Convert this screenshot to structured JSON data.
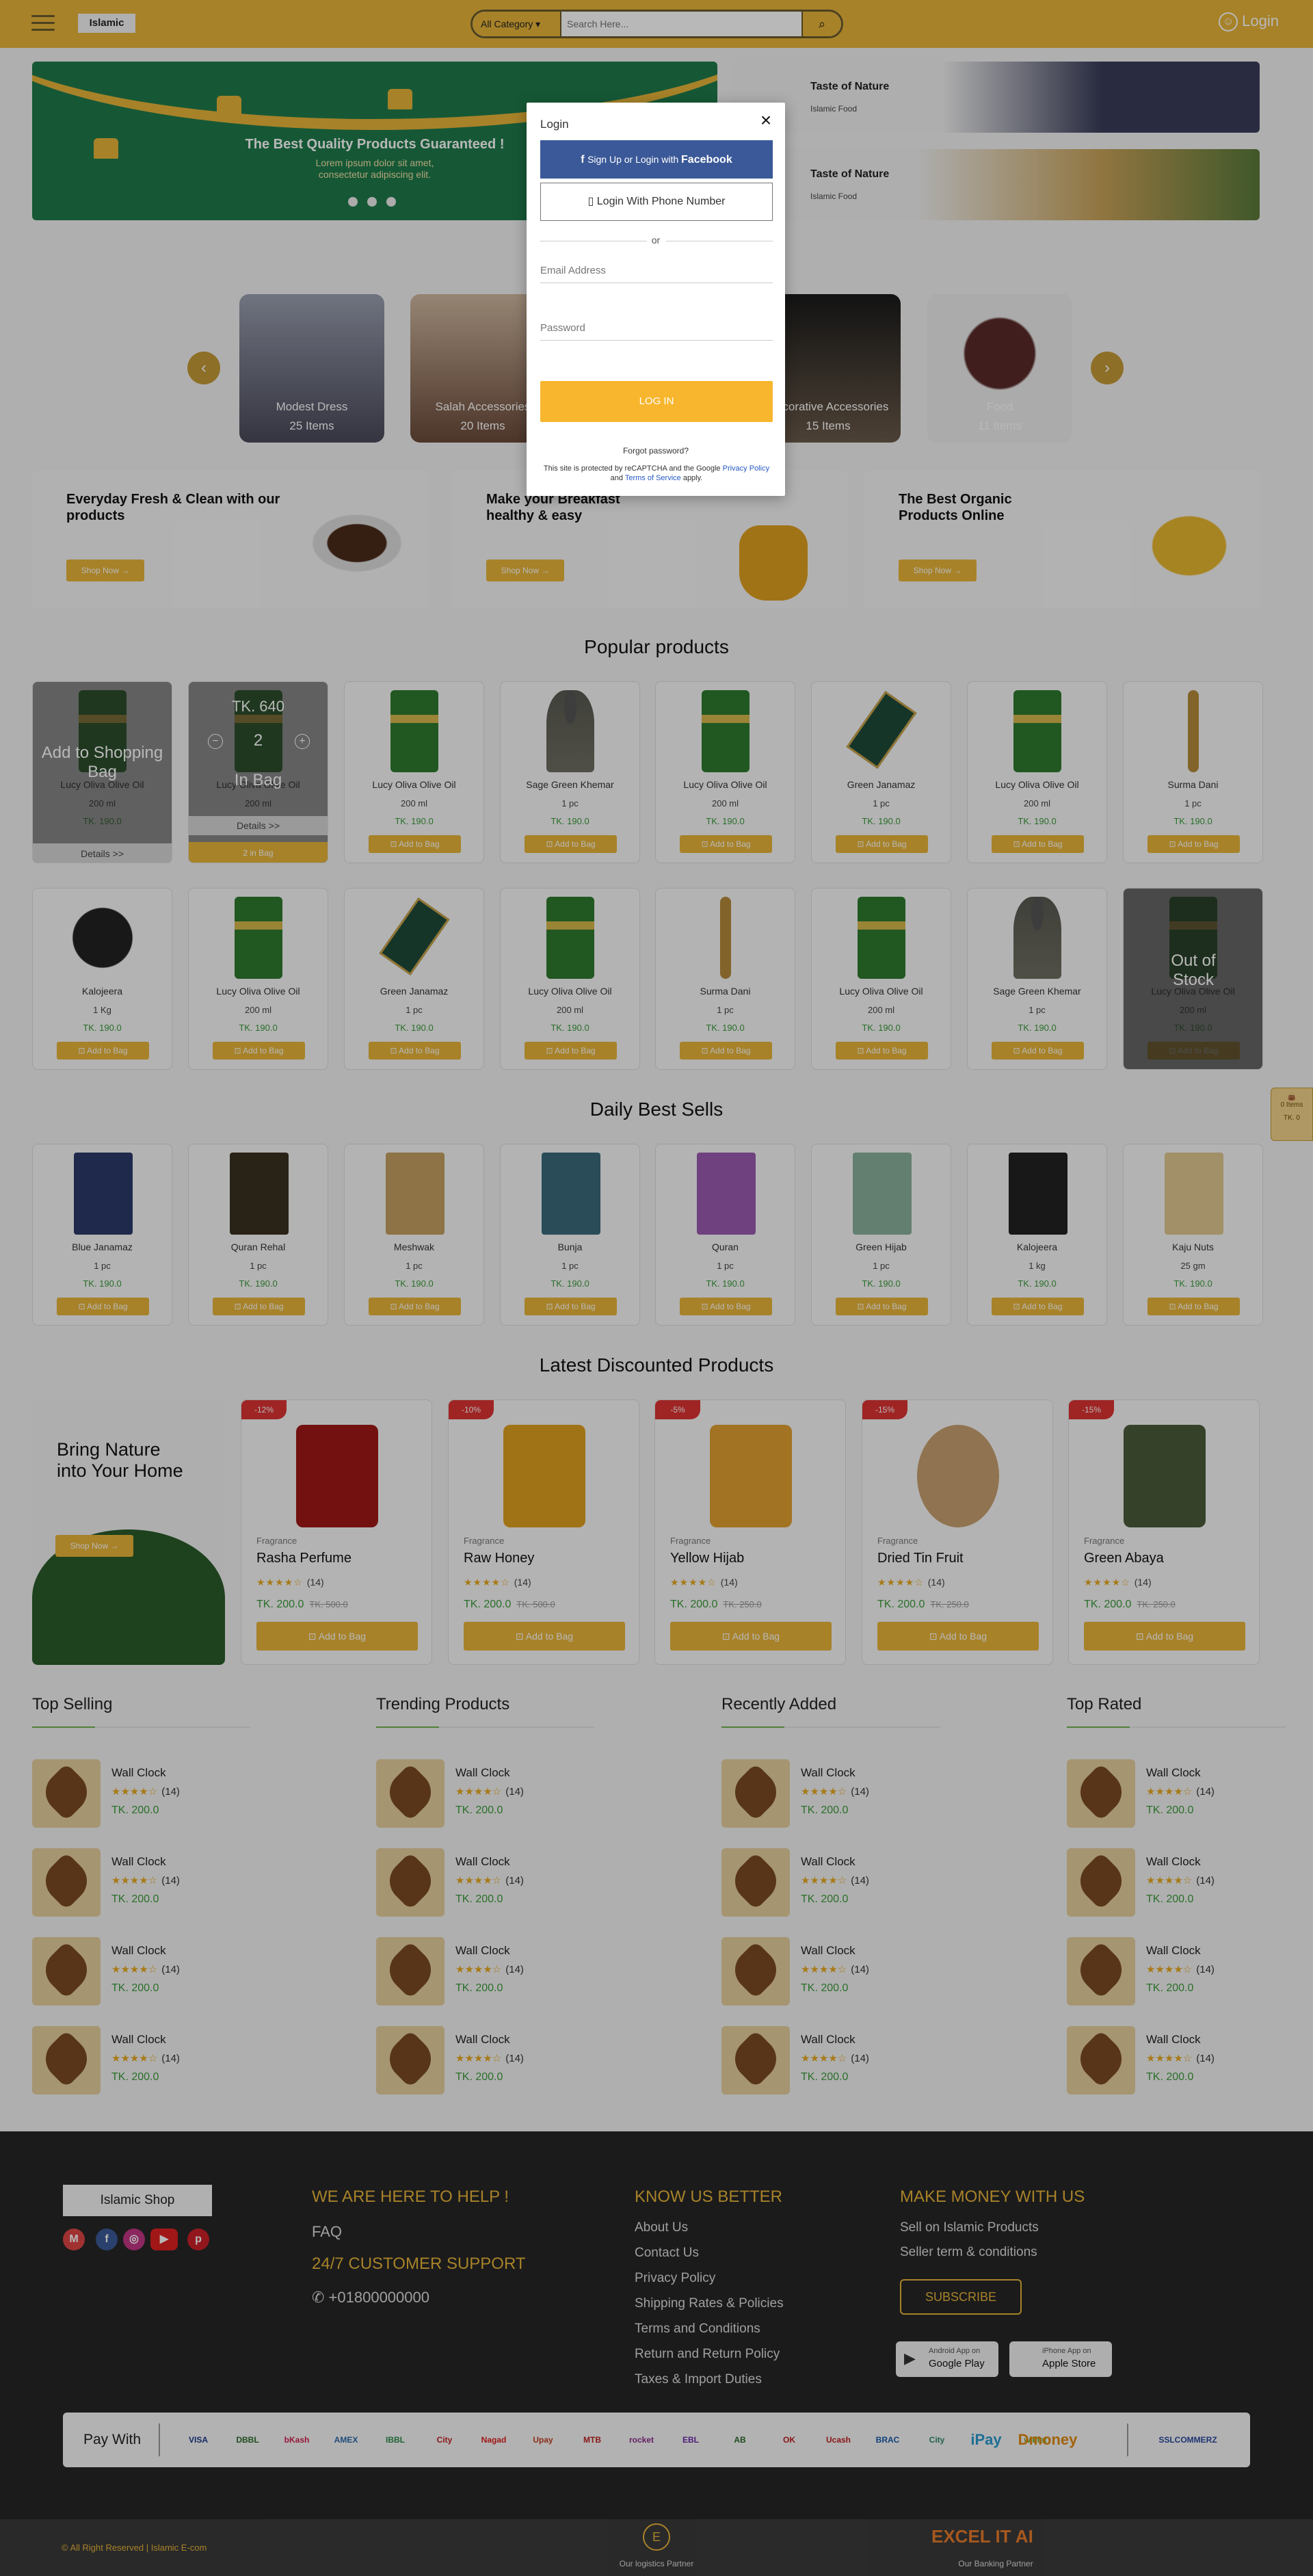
{
  "header": {
    "logo": "Islamic",
    "category_select": "All Category",
    "search_placeholder": "Search Here...",
    "login": "Login"
  },
  "hero": {
    "title": "The Best Quality Products Guaranteed !",
    "subtitle": "Lorem ipsum dolor sit amet,",
    "subtitle2": "consectetur adipiscing elit."
  },
  "side_banners": [
    {
      "title": "Taste of Nature",
      "sub": "Islamic Food"
    },
    {
      "title": "Taste of Nature",
      "sub": "Islamic Food"
    }
  ],
  "categories": [
    {
      "name": "Modest Dress",
      "count": "25 Items",
      "color": "#6b6a7a"
    },
    {
      "name": "Salah Accessories",
      "count": "20 Items",
      "color": "#8a6b52"
    },
    {
      "name": "Decorative Accessories",
      "count": "15 Items",
      "color": "#5a4a3a"
    },
    {
      "name": "Food",
      "count": "11 Items",
      "color": "#8a7a7a"
    }
  ],
  "promos": [
    {
      "title": "Everyday Fresh & Clean with our products",
      "btn": "Shop Now"
    },
    {
      "title": "Make your Breakfast healthy & easy",
      "btn": "Shop Now"
    },
    {
      "title": "The Best Organic Products Online",
      "btn": "Shop Now"
    }
  ],
  "popular_title": "Popular products",
  "popular_row1": [
    {
      "name": "Lucy Oliva Olive Oil",
      "qty": "200 ml",
      "price": "TK. 190.0",
      "img": "oil"
    },
    {
      "name": "Lucy Oliva Olive Oil",
      "qty": "200 ml",
      "price": "TK. 190.0",
      "img": "oil"
    },
    {
      "name": "Lucy Oliva Olive Oil",
      "qty": "200 ml",
      "price": "TK. 190.0",
      "img": "oil"
    },
    {
      "name": "Sage Green Khemar",
      "qty": "1 pc",
      "price": "TK. 190.0",
      "img": "khemar"
    },
    {
      "name": "Lucy Oliva Olive Oil",
      "qty": "200 ml",
      "price": "TK. 190.0",
      "img": "oil"
    },
    {
      "name": "Green Janamaz",
      "qty": "1 pc",
      "price": "TK. 190.0",
      "img": "mat"
    },
    {
      "name": "Lucy Oliva Olive Oil",
      "qty": "200 ml",
      "price": "TK. 190.0",
      "img": "oil"
    },
    {
      "name": "Surma Dani",
      "qty": "1 pc",
      "price": "TK. 190.0",
      "img": "dani"
    }
  ],
  "popular_row2": [
    {
      "name": "Kalojeera",
      "qty": "1 Kg",
      "price": "TK. 190.0",
      "img": "seeds"
    },
    {
      "name": "Lucy Oliva Olive Oil",
      "qty": "200 ml",
      "price": "TK. 190.0",
      "img": "oil"
    },
    {
      "name": "Green Janamaz",
      "qty": "1 pc",
      "price": "TK. 190.0",
      "img": "mat"
    },
    {
      "name": "Lucy Oliva Olive Oil",
      "qty": "200 ml",
      "price": "TK. 190.0",
      "img": "oil"
    },
    {
      "name": "Surma Dani",
      "qty": "1 pc",
      "price": "TK. 190.0",
      "img": "dani"
    },
    {
      "name": "Lucy Oliva Olive Oil",
      "qty": "200 ml",
      "price": "TK. 190.0",
      "img": "oil"
    },
    {
      "name": "Sage Green Khemar",
      "qty": "1 pc",
      "price": "TK. 190.0",
      "img": "khemar"
    },
    {
      "name": "Lucy Oliva Olive Oil",
      "qty": "200 ml",
      "price": "TK. 190.0",
      "img": "oil"
    }
  ],
  "add_to_bag": "Add to Bag",
  "card_states": {
    "add_overlay": "Add to Shopping Bag",
    "details": "Details >>",
    "bag_price": "TK. 640",
    "bag_qty": "2",
    "in_bag": "In Bag",
    "in_bag_btn": "2 in Bag",
    "out_of_stock": "Out of Stock"
  },
  "daily_title": "Daily Best Sells",
  "daily": [
    {
      "name": "Blue Janamaz",
      "qty": "1 pc",
      "price": "TK. 190.0",
      "color": "#2a3a6a"
    },
    {
      "name": "Quran Rehal",
      "qty": "1 pc",
      "price": "TK. 190.0",
      "color": "#3a3020"
    },
    {
      "name": "Meshwak",
      "qty": "1 pc",
      "price": "TK. 190.0",
      "color": "#c4a060"
    },
    {
      "name": "Bunja",
      "qty": "1 pc",
      "price": "TK. 190.0",
      "color": "#3a6a7a"
    },
    {
      "name": "Quran",
      "qty": "1 pc",
      "price": "TK. 190.0",
      "color": "#9a5ab0"
    },
    {
      "name": "Green Hijab",
      "qty": "1 pc",
      "price": "TK. 190.0",
      "color": "#8ab09a"
    },
    {
      "name": "Kalojeera",
      "qty": "1 kg",
      "price": "TK. 190.0",
      "color": "#222222"
    },
    {
      "name": "Kaju Nuts",
      "qty": "25 gm",
      "price": "TK. 190.0",
      "color": "#e0c890"
    }
  ],
  "discount_title": "Latest Discounted Products",
  "discount_banner": {
    "title": "Bring Nature into Your Home",
    "btn": "Shop Now"
  },
  "discounted": [
    {
      "badge": "-12%",
      "cat": "Fragrance",
      "name": "Rasha Perfume",
      "reviews": "(14)",
      "price": "TK. 200.0",
      "old": "TK. 500.0",
      "btn": "Add to Bag",
      "color": "#a01818"
    },
    {
      "badge": "-10%",
      "cat": "Fragrance",
      "name": "Raw Honey",
      "reviews": "(14)",
      "price": "TK. 200.0",
      "old": "TK. 500.0",
      "btn": "Add to Bag",
      "color": "#e0a020"
    },
    {
      "badge": "-5%",
      "cat": "Fragrance",
      "name": "Yellow Hijab",
      "reviews": "(14)",
      "price": "TK. 200.0",
      "old": "TK. 250.0",
      "btn": "Add to Bag",
      "color": "#e0a030"
    },
    {
      "badge": "-15%",
      "cat": "Fragrance",
      "name": "Dried Tin Fruit",
      "reviews": "(14)",
      "price": "TK. 200.0",
      "old": "TK. 250.0",
      "btn": "Add to Bag",
      "color": "#c8a070"
    },
    {
      "badge": "-15%",
      "cat": "Fragrance",
      "name": "Green Abaya",
      "reviews": "(14)",
      "price": "TK. 200.0",
      "old": "TK. 250.0",
      "btn": "Add to Bag",
      "color": "#4a5a3a"
    }
  ],
  "stars": "★★★★☆",
  "list_columns": [
    {
      "title": "Top Selling"
    },
    {
      "title": "Trending Products"
    },
    {
      "title": "Recently Added"
    },
    {
      "title": "Top Rated"
    }
  ],
  "list_item": {
    "name": "Wall Clock",
    "reviews": "(14)",
    "price": "TK. 200.0"
  },
  "footer": {
    "logo": "Islamic Shop",
    "help_title": "WE ARE HERE TO HELP !",
    "faq": "FAQ",
    "support": "24/7 CUSTOMER SUPPORT",
    "phone": "+01800000000",
    "know_title": "KNOW US BETTER",
    "know_links": [
      "About Us",
      "Contact Us",
      "Privacy Policy",
      "Shipping Rates & Policies",
      "Terms and Conditions",
      "Return and Return Policy",
      "Taxes & Import Duties"
    ],
    "money_title": "MAKE MONEY WITH US",
    "money_links": [
      "Sell on Islamic Products",
      "Seller term & conditions"
    ],
    "subscribe": "SUBSCRIBE",
    "google_small": "Android App on",
    "google": "Google Play",
    "apple_small": "iPhone App on",
    "apple": "Apple Store",
    "pay_with": "Pay With",
    "pay_logos": [
      "VISA",
      "DBBL",
      "bKash",
      "AMEX",
      "IBBL",
      "City",
      "Nagad",
      "Upay",
      "MTB",
      "rocket",
      "EBL",
      "AB",
      "OK",
      "Ucash",
      "BRAC",
      "City",
      "iPay",
      "wallet",
      "Dmoney",
      "SSLCOMMERZ"
    ],
    "copyright": "© All Right Reserved | Islamic E-com",
    "logistics": "Our logistics Partner",
    "banking": "Our Banking Partner",
    "excel": "EXCEL IT AI"
  },
  "modal": {
    "title": "Login",
    "fb_pre": "Sign Up or Login with ",
    "fb": "Facebook",
    "phone_pre": "Login With ",
    "phone": "Phone Number",
    "or": "or",
    "email_placeholder": "Email Address",
    "password_placeholder": "Password",
    "login_btn": "LOG IN",
    "forgot": "Forgot password?",
    "captcha1": "This site is protected by reCAPTCHA and the Google ",
    "privacy": "Privacy Policy",
    "and": " and ",
    "terms": "Terms of Service",
    "apply": " apply."
  },
  "float_widget": {
    "label": "0 Items",
    "price": "TK. 0"
  }
}
